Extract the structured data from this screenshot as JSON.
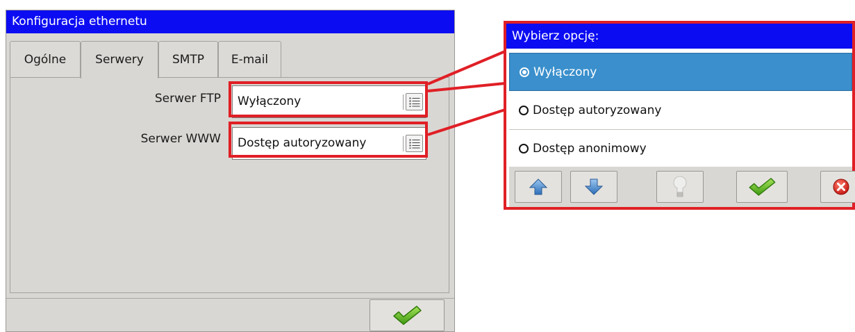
{
  "window": {
    "title": "Konfiguracja ethernetu",
    "tabs": [
      {
        "label": "Ogólne"
      },
      {
        "label": "Serwery"
      },
      {
        "label": "SMTP"
      },
      {
        "label": "E-mail"
      }
    ],
    "active_tab": "Serwery",
    "fields": {
      "ftp": {
        "label": "Serwer FTP",
        "value": "Wyłączony"
      },
      "www": {
        "label": "Serwer WWW",
        "value": "Dostęp autoryzowany"
      }
    },
    "footer": {
      "ok_icon": "checkmark-icon"
    }
  },
  "popup": {
    "title": "Wybierz opcję:",
    "options": [
      {
        "label": "Wyłączony",
        "selected": true
      },
      {
        "label": "Dostęp autoryzowany",
        "selected": false
      },
      {
        "label": "Dostęp anonimowy",
        "selected": false
      }
    ],
    "toolbar_icons": [
      "arrow-up-icon",
      "arrow-down-icon",
      "lightbulb-icon",
      "checkmark-icon",
      "cancel-icon"
    ]
  },
  "colors": {
    "titlebar": "#0c0cf3",
    "selection": "#3a8fcc",
    "highlight": "#e01f26",
    "panel": "#d9d7d3"
  }
}
